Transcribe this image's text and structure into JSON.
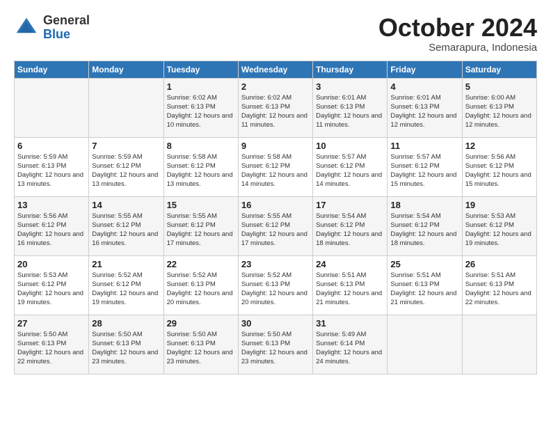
{
  "header": {
    "logo_general": "General",
    "logo_blue": "Blue",
    "month_title": "October 2024",
    "location": "Semarapura, Indonesia"
  },
  "days_of_week": [
    "Sunday",
    "Monday",
    "Tuesday",
    "Wednesday",
    "Thursday",
    "Friday",
    "Saturday"
  ],
  "weeks": [
    [
      {
        "day": "",
        "detail": ""
      },
      {
        "day": "",
        "detail": ""
      },
      {
        "day": "1",
        "detail": "Sunrise: 6:02 AM\nSunset: 6:13 PM\nDaylight: 12 hours\nand 10 minutes."
      },
      {
        "day": "2",
        "detail": "Sunrise: 6:02 AM\nSunset: 6:13 PM\nDaylight: 12 hours\nand 11 minutes."
      },
      {
        "day": "3",
        "detail": "Sunrise: 6:01 AM\nSunset: 6:13 PM\nDaylight: 12 hours\nand 11 minutes."
      },
      {
        "day": "4",
        "detail": "Sunrise: 6:01 AM\nSunset: 6:13 PM\nDaylight: 12 hours\nand 12 minutes."
      },
      {
        "day": "5",
        "detail": "Sunrise: 6:00 AM\nSunset: 6:13 PM\nDaylight: 12 hours\nand 12 minutes."
      }
    ],
    [
      {
        "day": "6",
        "detail": "Sunrise: 5:59 AM\nSunset: 6:13 PM\nDaylight: 12 hours\nand 13 minutes."
      },
      {
        "day": "7",
        "detail": "Sunrise: 5:59 AM\nSunset: 6:12 PM\nDaylight: 12 hours\nand 13 minutes."
      },
      {
        "day": "8",
        "detail": "Sunrise: 5:58 AM\nSunset: 6:12 PM\nDaylight: 12 hours\nand 13 minutes."
      },
      {
        "day": "9",
        "detail": "Sunrise: 5:58 AM\nSunset: 6:12 PM\nDaylight: 12 hours\nand 14 minutes."
      },
      {
        "day": "10",
        "detail": "Sunrise: 5:57 AM\nSunset: 6:12 PM\nDaylight: 12 hours\nand 14 minutes."
      },
      {
        "day": "11",
        "detail": "Sunrise: 5:57 AM\nSunset: 6:12 PM\nDaylight: 12 hours\nand 15 minutes."
      },
      {
        "day": "12",
        "detail": "Sunrise: 5:56 AM\nSunset: 6:12 PM\nDaylight: 12 hours\nand 15 minutes."
      }
    ],
    [
      {
        "day": "13",
        "detail": "Sunrise: 5:56 AM\nSunset: 6:12 PM\nDaylight: 12 hours\nand 16 minutes."
      },
      {
        "day": "14",
        "detail": "Sunrise: 5:55 AM\nSunset: 6:12 PM\nDaylight: 12 hours\nand 16 minutes."
      },
      {
        "day": "15",
        "detail": "Sunrise: 5:55 AM\nSunset: 6:12 PM\nDaylight: 12 hours\nand 17 minutes."
      },
      {
        "day": "16",
        "detail": "Sunrise: 5:55 AM\nSunset: 6:12 PM\nDaylight: 12 hours\nand 17 minutes."
      },
      {
        "day": "17",
        "detail": "Sunrise: 5:54 AM\nSunset: 6:12 PM\nDaylight: 12 hours\nand 18 minutes."
      },
      {
        "day": "18",
        "detail": "Sunrise: 5:54 AM\nSunset: 6:12 PM\nDaylight: 12 hours\nand 18 minutes."
      },
      {
        "day": "19",
        "detail": "Sunrise: 5:53 AM\nSunset: 6:12 PM\nDaylight: 12 hours\nand 19 minutes."
      }
    ],
    [
      {
        "day": "20",
        "detail": "Sunrise: 5:53 AM\nSunset: 6:12 PM\nDaylight: 12 hours\nand 19 minutes."
      },
      {
        "day": "21",
        "detail": "Sunrise: 5:52 AM\nSunset: 6:12 PM\nDaylight: 12 hours\nand 19 minutes."
      },
      {
        "day": "22",
        "detail": "Sunrise: 5:52 AM\nSunset: 6:13 PM\nDaylight: 12 hours\nand 20 minutes."
      },
      {
        "day": "23",
        "detail": "Sunrise: 5:52 AM\nSunset: 6:13 PM\nDaylight: 12 hours\nand 20 minutes."
      },
      {
        "day": "24",
        "detail": "Sunrise: 5:51 AM\nSunset: 6:13 PM\nDaylight: 12 hours\nand 21 minutes."
      },
      {
        "day": "25",
        "detail": "Sunrise: 5:51 AM\nSunset: 6:13 PM\nDaylight: 12 hours\nand 21 minutes."
      },
      {
        "day": "26",
        "detail": "Sunrise: 5:51 AM\nSunset: 6:13 PM\nDaylight: 12 hours\nand 22 minutes."
      }
    ],
    [
      {
        "day": "27",
        "detail": "Sunrise: 5:50 AM\nSunset: 6:13 PM\nDaylight: 12 hours\nand 22 minutes."
      },
      {
        "day": "28",
        "detail": "Sunrise: 5:50 AM\nSunset: 6:13 PM\nDaylight: 12 hours\nand 23 minutes."
      },
      {
        "day": "29",
        "detail": "Sunrise: 5:50 AM\nSunset: 6:13 PM\nDaylight: 12 hours\nand 23 minutes."
      },
      {
        "day": "30",
        "detail": "Sunrise: 5:50 AM\nSunset: 6:13 PM\nDaylight: 12 hours\nand 23 minutes."
      },
      {
        "day": "31",
        "detail": "Sunrise: 5:49 AM\nSunset: 6:14 PM\nDaylight: 12 hours\nand 24 minutes."
      },
      {
        "day": "",
        "detail": ""
      },
      {
        "day": "",
        "detail": ""
      }
    ]
  ]
}
